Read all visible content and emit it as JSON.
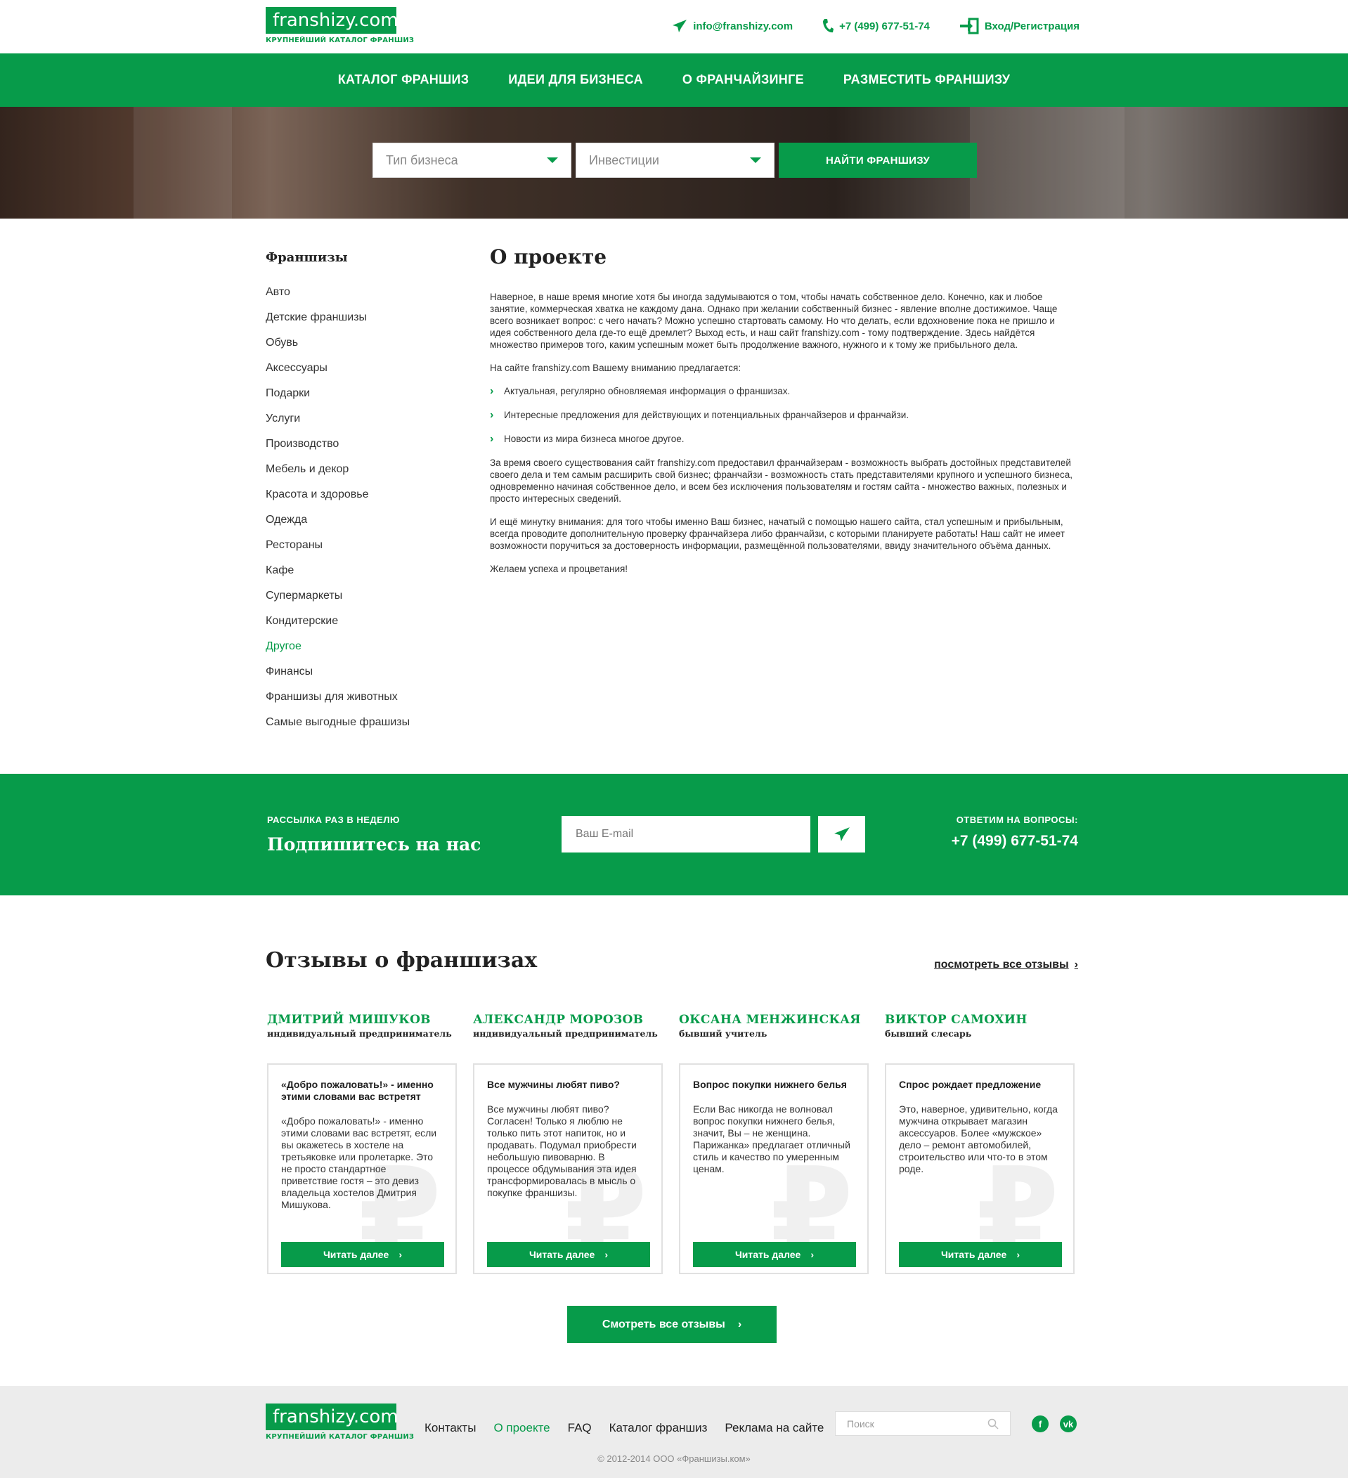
{
  "header": {
    "logo_text": "franshizy.com",
    "logo_sub": "КРУПНЕЙШИЙ КАТАЛОГ ФРАНШИЗ",
    "email": "info@franshizy.com",
    "phone": "+7 (499) 677-51-74",
    "login": "Вход/Регистрация"
  },
  "nav": [
    "КАТАЛОГ ФРАНШИЗ",
    "ИДЕИ ДЛЯ БИЗНЕСА",
    "О ФРАНЧАЙЗИНГЕ",
    "РАЗМЕСТИТЬ ФРАНШИЗУ"
  ],
  "search": {
    "type_placeholder": "Тип бизнеса",
    "invest_placeholder": "Инвестиции",
    "button": "НАЙТИ ФРАНШИЗУ"
  },
  "sidebar": {
    "title": "Франшизы",
    "items": [
      "Авто",
      "Детские франшизы",
      "Обувь",
      "Аксессуары",
      "Подарки",
      "Услуги",
      "Производство",
      "Мебель и декор",
      "Красота и здоровье",
      "Одежда",
      "Рестораны",
      "Кафе",
      "Супермаркеты",
      "Кондитерские",
      "Другое",
      "Финансы",
      "Франшизы для животных",
      "Самые выгодные фрашизы"
    ],
    "active_index": 14
  },
  "main": {
    "title": "О проекте",
    "p1": "Наверное, в наше время многие хотя бы иногда задумываются о том, чтобы начать собственное дело. Конечно, как и любое занятие, коммерческая хватка не каждому дана. Однако при желании собственный бизнес - явление вполне достижимое. Чаще всего возникает вопрос: с чего начать? Можно успешно стартовать самому. Но что делать, если вдохновение пока не пришло и идея собственного дела где-то ещё дремлет? Выход есть, и наш сайт franshizy.com - тому подтверждение. Здесь найдётся множество примеров того, каким успешным может быть продолжение важного, нужного и к тому же прибыльного дела.",
    "p2": "На сайте franshizy.com Вашему вниманию предлагается:",
    "bullets": [
      "Актуальная, регулярно обновляемая информация о франшизах.",
      "Интересные предложения для действующих и потенциальных франчайзеров и франчайзи.",
      "Новости из мира бизнеса многое другое."
    ],
    "p3": "За время своего существования сайт franshizy.com предоставил франчайзерам - возможность выбрать достойных представителей своего дела и тем самым расширить свой бизнес; франчайзи - возможность стать представителями крупного и успешного бизнеса, одновременно начиная собственное дело, и всем без исключения пользователям и гостям сайта - множество важных, полезных и просто интересных сведений.",
    "p4": "И ещё минутку внимания: для того чтобы именно Ваш бизнес, начатый с помощью нашего сайта, стал успешным и прибыльным, всегда проводите дополнительную проверку франчайзера либо франчайзи, с которыми планируете работать! Наш сайт не имеет возможности поручиться за достоверность информации, размещённой пользователями, ввиду значительного объёма данных.",
    "p5": "Желаем успеха и процветания!"
  },
  "subscribe": {
    "label": "РАССЫЛКА РАЗ В НЕДЕЛЮ",
    "title": "Подпишитесь на нас",
    "email_placeholder": "Ваш E-mail",
    "answer_label": "ОТВЕТИМ НА ВОПРОСЫ:",
    "phone": "+7 (499) 677-51-74"
  },
  "reviews": {
    "title": "Отзывы о франшизах",
    "see_all_link": "посмотреть все отзывы",
    "read_more": "Читать далее",
    "all_button": "Смотреть все отзывы",
    "cards": [
      {
        "name": "ДМИТРИЙ МИШУКОВ",
        "role": "индивидуальный предприниматель",
        "title": "«Добро пожаловать!» - именно этими словами вас встретят",
        "text": "«Добро пожаловать!» - именно этими словами вас встретят, если вы окажетесь в хостеле на третьяковке или пролетарке. Это не просто стандартное приветствие гостя – это девиз владельца хостелов Дмитрия Мишукова."
      },
      {
        "name": "АЛЕКСАНДР МОРОЗОВ",
        "role": "индивидуальный предприниматель",
        "title": "Все мужчины любят пиво?",
        "text": "Все мужчины любят пиво? Согласен! Только я люблю не только пить этот напиток, но и продавать. Подумал приобрести небольшую пивоварню. В процессе обдумывания эта идея трансформировалась в мысль о покупке франшизы."
      },
      {
        "name": "ОКСАНА МЕНЖИНСКАЯ",
        "role": "бывший учитель",
        "title": "Вопрос покупки нижнего белья",
        "text": "Если Вас никогда не волновал вопрос покупки нижнего белья, значит, Вы – не женщина. Парижанка» предлагает отличный стиль и качество по умеренным ценам."
      },
      {
        "name": "ВИКТОР САМОХИН",
        "role": "бывший слесарь",
        "title": "Спрос рождает предложение",
        "text": "Это, наверное, удивительно, когда мужчина открывает магазин аксессуаров. Более «мужское» дело – ремонт автомобилей, строительство или что-то в этом роде."
      }
    ]
  },
  "footer": {
    "links": [
      "Контакты",
      "О проекте",
      "FAQ",
      "Каталог франшиз",
      "Реклама на сайте"
    ],
    "active_index": 1,
    "search_placeholder": "Поиск",
    "social": [
      "facebook-icon",
      "vk-icon"
    ],
    "copyright": "© 2012-2014 ООО «Франшизы.ком»"
  },
  "colors": {
    "accent": "#079b4a"
  }
}
